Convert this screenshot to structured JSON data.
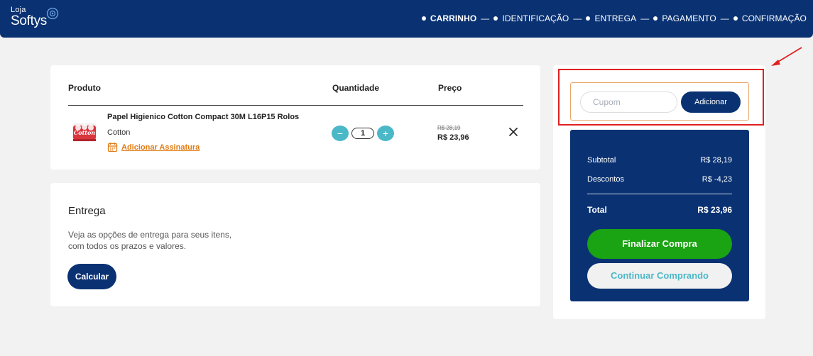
{
  "header": {
    "logo_line1": "Loja",
    "logo_line2": "Softys",
    "steps": [
      {
        "label": "CARRINHO",
        "active": true
      },
      {
        "label": "IDENTIFICAÇÃO",
        "active": false
      },
      {
        "label": "ENTREGA",
        "active": false
      },
      {
        "label": "PAGAMENTO",
        "active": false
      },
      {
        "label": "CONFIRMAÇÃO",
        "active": false
      }
    ],
    "separator": "—"
  },
  "cart": {
    "headers": {
      "product": "Produto",
      "quantity": "Quantidade",
      "price": "Preço"
    },
    "items": [
      {
        "name": "Papel Higienico Cotton Compact 30M L16P15 Rolos",
        "brand": "Cotton",
        "subscription_link": "Adicionar Assinatura",
        "quantity": "1",
        "decrease_icon": "−",
        "increase_icon": "+",
        "old_price": "R$ 28,19",
        "price": "R$ 23,96",
        "image_label": "Cotton"
      }
    ]
  },
  "delivery": {
    "title": "Entrega",
    "description_line1": "Veja as opções de entrega para seus itens,",
    "description_line2": "com todos os prazos e valores.",
    "button": "Calcular"
  },
  "coupon": {
    "placeholder": "Cupom",
    "value": "",
    "button": "Adicionar"
  },
  "summary": {
    "subtotal_label": "Subtotal",
    "subtotal_value": "R$ 28,19",
    "discount_label": "Descontos",
    "discount_value": "R$ -4,23",
    "total_label": "Total",
    "total_value": "R$ 23,96",
    "finish_button": "Finalizar Compra",
    "continue_button": "Continuar Comprando"
  },
  "colors": {
    "brand_navy": "#0a3273",
    "accent_teal": "#4bb8c8",
    "success_green": "#1aa312",
    "link_orange": "#e07a12",
    "annotation_red": "#e02020"
  }
}
